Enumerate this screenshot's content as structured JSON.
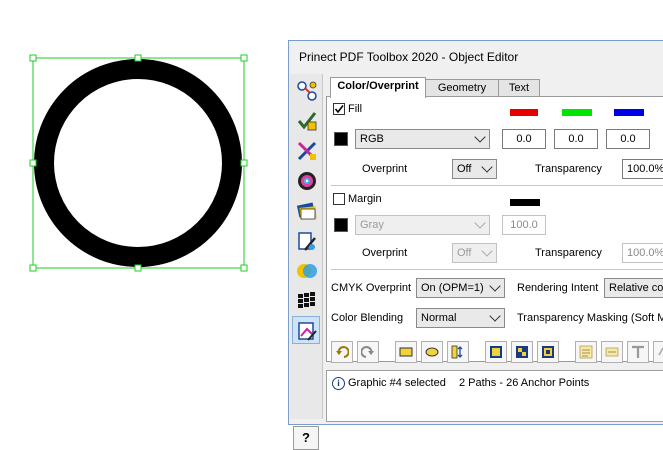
{
  "window": {
    "title": "Prinect PDF Toolbox 2020 - Object Editor"
  },
  "tabs": [
    {
      "label": "Color/Overprint"
    },
    {
      "label": "Geometry"
    },
    {
      "label": "Text"
    }
  ],
  "fill": {
    "checkbox_label": "Fill",
    "checked": true,
    "color_space": "RGB",
    "values": [
      "0.0",
      "0.0",
      "0.0"
    ],
    "channel_colors": [
      "#e60000",
      "#00e600",
      "#0000e6"
    ],
    "overprint_label": "Overprint",
    "overprint_value": "Off",
    "transparency_label": "Transparency",
    "transparency_value": "100.0%"
  },
  "margin": {
    "checkbox_label": "Margin",
    "checked": false,
    "color_space": "Gray",
    "value": "100.0",
    "channel_color": "#000000",
    "overprint_label": "Overprint",
    "overprint_value": "Off",
    "transparency_label": "Transparency",
    "transparency_value": "100.0%"
  },
  "options": {
    "cmyk_overprint_label": "CMYK Overprint",
    "cmyk_overprint_value": "On (OPM=1)",
    "rendering_intent_label": "Rendering Intent",
    "rendering_intent_value": "Relative col",
    "color_blending_label": "Color Blending",
    "color_blending_value": "Normal",
    "transparency_masking_label": "Transparency Masking (Soft M"
  },
  "status": {
    "info_icon": "info-icon",
    "message": "Graphic #4 selected",
    "details": "2 Paths - 26 Anchor Points"
  },
  "help_label": "?",
  "selection_color": "#22cc22"
}
